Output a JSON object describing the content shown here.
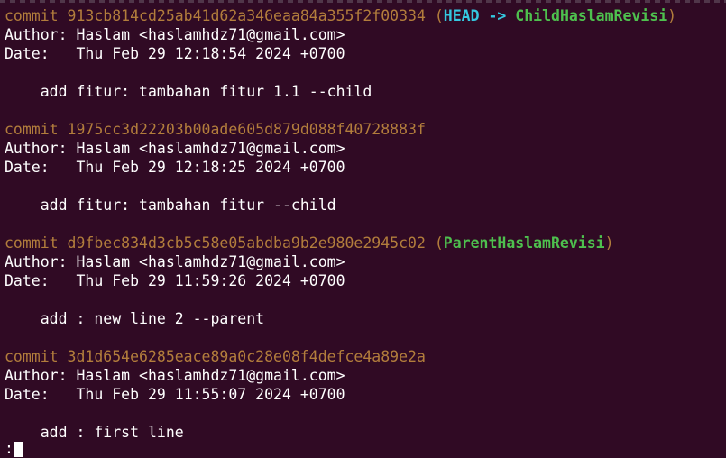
{
  "commits": [
    {
      "keyword": "commit",
      "hash": "913cb814cd25ab41d62a346eaa84a355f2f00334",
      "refs": {
        "open": "(",
        "head": "HEAD",
        "arrow": "->",
        "branch": "ChildHaslamRevisi",
        "close": ")"
      },
      "author_label": "Author:",
      "author": "Haslam <haslamhdz71@gmail.com>",
      "date_label": "Date:",
      "date": "Thu Feb 29 12:18:54 2024 +0700",
      "message": "add fitur: tambahan fitur 1.1 --child"
    },
    {
      "keyword": "commit",
      "hash": "1975cc3d22203b00ade605d879d088f40728883f",
      "author_label": "Author:",
      "author": "Haslam <haslamhdz71@gmail.com>",
      "date_label": "Date:",
      "date": "Thu Feb 29 12:18:25 2024 +0700",
      "message": "add fitur: tambahan fitur --child"
    },
    {
      "keyword": "commit",
      "hash": "d9fbec834d3cb5c58e05abdba9b2e980e2945c02",
      "refs": {
        "open": "(",
        "branch": "ParentHaslamRevisi",
        "close": ")"
      },
      "author_label": "Author:",
      "author": "Haslam <haslamhdz71@gmail.com>",
      "date_label": "Date:",
      "date": "Thu Feb 29 11:59:26 2024 +0700",
      "message": "add : new line 2 --parent"
    },
    {
      "keyword": "commit",
      "hash": "3d1d654e6285eace89a0c28e08f4defce4a89e2a",
      "author_label": "Author:",
      "author": "Haslam <haslamhdz71@gmail.com>",
      "date_label": "Date:",
      "date": "Thu Feb 29 11:55:07 2024 +0700",
      "message": "add : first line"
    }
  ],
  "pager": {
    "prompt": ":"
  },
  "colors": {
    "background": "#300a24",
    "foreground": "#ffffff",
    "commit": "#b27d3c",
    "head_ref": "#34c8e0",
    "branch_ref": "#4ec04e"
  }
}
